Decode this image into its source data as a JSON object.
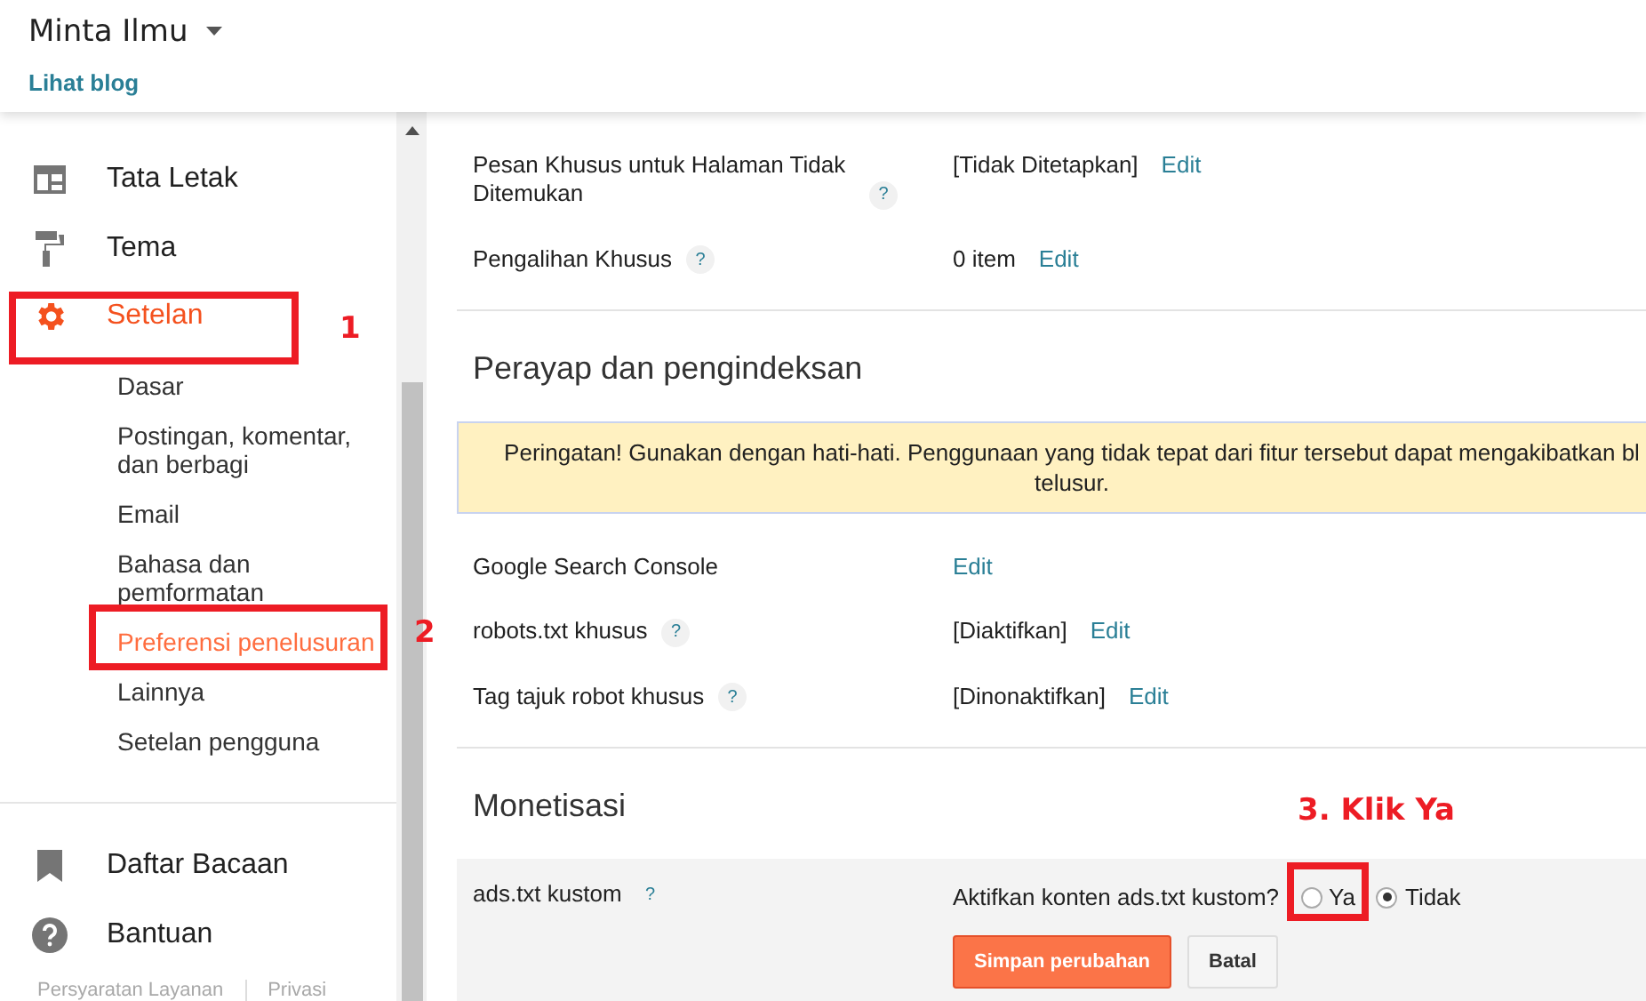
{
  "header": {
    "blog_title": "Minta Ilmu",
    "view_link": "Lihat blog"
  },
  "sidebar": {
    "items": [
      {
        "label": "Tata Letak",
        "selected": false
      },
      {
        "label": "Tema",
        "selected": false
      },
      {
        "label": "Setelan",
        "selected": true,
        "children": [
          {
            "label": "Dasar",
            "selected": false
          },
          {
            "label": "Postingan, komentar, dan berbagi",
            "selected": false
          },
          {
            "label": "Email",
            "selected": false
          },
          {
            "label": "Bahasa dan pemformatan",
            "selected": false
          },
          {
            "label": "Preferensi penelusuran",
            "selected": true
          },
          {
            "label": "Lainnya",
            "selected": false
          },
          {
            "label": "Setelan pengguna",
            "selected": false
          }
        ]
      }
    ],
    "bottom_items": [
      {
        "label": "Daftar Bacaan"
      },
      {
        "label": "Bantuan"
      }
    ],
    "footer_links": [
      "Persyaratan Layanan",
      "Privasi"
    ]
  },
  "sections": [
    {
      "rows": [
        {
          "label": "Pesan Khusus untuk Halaman Tidak Ditemukan",
          "help": "?",
          "value": "[Tidak Ditetapkan]",
          "link": "Edit"
        },
        {
          "label": "Pengalihan Khusus",
          "help": "?",
          "value": "0 item",
          "link": "Edit"
        }
      ]
    },
    {
      "title": "Perayap dan pengindeksan",
      "warning": "Peringatan! Gunakan dengan hati-hati. Penggunaan yang tidak tepat dari fitur tersebut dapat mengakibatkan bl\ntelusur.",
      "rows": [
        {
          "label": "Google Search Console",
          "link": "Edit"
        },
        {
          "label": "robots.txt khusus",
          "help": "?",
          "value": "[Diaktifkan]",
          "link": "Edit"
        },
        {
          "label": "Tag tajuk robot khusus",
          "help": "?",
          "value": "[Dinonaktifkan]",
          "link": "Edit"
        }
      ]
    },
    {
      "title": "Monetisasi",
      "editor": {
        "label": "ads.txt kustom",
        "help": "?",
        "question": "Aktifkan konten ads.txt kustom?",
        "options": [
          {
            "label": "Ya",
            "selected": false
          },
          {
            "label": "Tidak",
            "selected": true
          }
        ],
        "save": "Simpan perubahan",
        "cancel": "Batal"
      }
    }
  ],
  "annotations": [
    {
      "kind": "box"
    },
    {
      "kind": "label",
      "text": "1"
    },
    {
      "kind": "box"
    },
    {
      "kind": "label",
      "text": "2"
    },
    {
      "kind": "box"
    },
    {
      "kind": "label",
      "text": "3. Klik Ya"
    }
  ]
}
